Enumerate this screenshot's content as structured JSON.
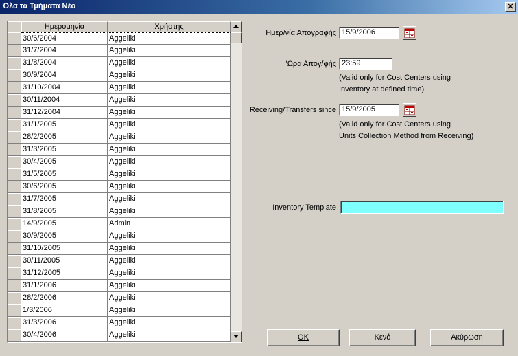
{
  "window": {
    "title": "Όλα τα Τμήματα  Νέο",
    "close_glyph": "✕"
  },
  "grid": {
    "columns": [
      "Ημερομηνία",
      "Χρήστης"
    ],
    "rows": [
      [
        "30/6/2004",
        "Aggeliki"
      ],
      [
        "31/7/2004",
        "Aggeliki"
      ],
      [
        "31/8/2004",
        "Aggeliki"
      ],
      [
        "30/9/2004",
        "Aggeliki"
      ],
      [
        "31/10/2004",
        "Aggeliki"
      ],
      [
        "30/11/2004",
        "Aggeliki"
      ],
      [
        "31/12/2004",
        "Aggeliki"
      ],
      [
        "31/1/2005",
        "Aggeliki"
      ],
      [
        "28/2/2005",
        "Aggeliki"
      ],
      [
        "31/3/2005",
        "Aggeliki"
      ],
      [
        "30/4/2005",
        "Aggeliki"
      ],
      [
        "31/5/2005",
        "Aggeliki"
      ],
      [
        "30/6/2005",
        "Aggeliki"
      ],
      [
        "31/7/2005",
        "Aggeliki"
      ],
      [
        "31/8/2005",
        "Aggeliki"
      ],
      [
        "14/9/2005",
        "Admin"
      ],
      [
        "30/9/2005",
        "Aggeliki"
      ],
      [
        "31/10/2005",
        "Aggeliki"
      ],
      [
        "30/11/2005",
        "Aggeliki"
      ],
      [
        "31/12/2005",
        "Aggeliki"
      ],
      [
        "31/1/2006",
        "Aggeliki"
      ],
      [
        "28/2/2006",
        "Aggeliki"
      ],
      [
        "1/3/2006",
        "Aggeliki"
      ],
      [
        "31/3/2006",
        "Aggeliki"
      ],
      [
        "30/4/2006",
        "Aggeliki"
      ]
    ],
    "selected_row": 0
  },
  "form": {
    "inventory_date_label": "Ημερ/νία Απογραφής",
    "inventory_date_value": "15/9/2006",
    "inventory_time_label": "'Ωρα Απογ/φής",
    "inventory_time_value": "23:59",
    "time_note_1": "(Valid only for Cost Centers using",
    "time_note_2": "Inventory at defined time)",
    "receiving_label": "Receiving/Transfers since",
    "receiving_value": "15/9/2005",
    "receiving_note_1": "(Valid only for Cost Centers using",
    "receiving_note_2": "Units Collection Method from Receiving)",
    "template_label": "Inventory Template",
    "template_value": "",
    "template_color": "#80ffff"
  },
  "buttons": {
    "ok": "OK",
    "clear": "Κενό",
    "cancel": "Ακύρωση"
  },
  "icons": {
    "calendar": "calendar-icon",
    "scroll_up": "arrow-up-icon",
    "scroll_down": "arrow-down-icon"
  }
}
